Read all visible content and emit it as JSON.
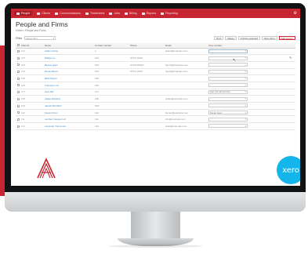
{
  "nav": {
    "items": [
      {
        "label": "People",
        "icon": "people-icon",
        "active": true
      },
      {
        "label": "Clients",
        "icon": "clients-icon"
      },
      {
        "label": "Communications",
        "icon": "communications-icon"
      },
      {
        "label": "Timesheets",
        "icon": "timesheets-icon"
      },
      {
        "label": "Jobs",
        "icon": "jobs-icon"
      },
      {
        "label": "Billing",
        "icon": "billing-icon"
      },
      {
        "label": "Reports",
        "icon": "reports-icon"
      },
      {
        "label": "Reporting",
        "icon": "reporting-icon"
      }
    ],
    "settings_icon": "gear-icon"
  },
  "page": {
    "title": "People and Firms",
    "breadcrumb": "Home / People and Firms"
  },
  "filters": {
    "label": "Filter",
    "select_value": "Select filter",
    "actions": [
      "Print",
      "Merge",
      "Archive selected",
      "New client",
      "Add person"
    ]
  },
  "table": {
    "headers": [
      "Client #",
      "Name",
      "Contact number",
      "Phone",
      "Email",
      "Xero contact"
    ],
    "rows": [
      {
        "id": "101",
        "name": "Adam Young",
        "contact": "1",
        "phone": "",
        "email": "adam@example.com",
        "xero": "",
        "focused": true
      },
      {
        "id": "102",
        "name": "Bridge Inc",
        "contact": "102",
        "phone": "07711 0129",
        "email": "",
        "xero": ""
      },
      {
        "id": "103",
        "name": "Becca Lloyd",
        "contact": "103",
        "phone": "01763 81921",
        "email": "becca@example.com",
        "xero": ""
      },
      {
        "id": "104",
        "name": "Derek Moore",
        "contact": "104",
        "phone": "07711 0129",
        "email": "derek@example.com",
        "xero": ""
      },
      {
        "id": "105",
        "name": "Eliza Reyes",
        "contact": "105",
        "phone": "",
        "email": "",
        "xero": ""
      },
      {
        "id": "106",
        "name": "Frampton Ltd",
        "contact": "106",
        "phone": "",
        "email": "",
        "xero": ""
      },
      {
        "id": "107",
        "name": "Hari Jain",
        "contact": "107",
        "phone": "",
        "email": "",
        "xero": "Hari Jain Enterprises"
      },
      {
        "id": "108",
        "name": "Isabel Hawkins",
        "contact": "108",
        "phone": "",
        "email": "isabel@example.com",
        "xero": ""
      },
      {
        "id": "109",
        "name": "Jacobs Brothers",
        "contact": "109",
        "phone": "",
        "email": "",
        "xero": ""
      },
      {
        "id": "110",
        "name": "Kieran Dunn",
        "contact": "110",
        "phone": "",
        "email": "kieran@example.com",
        "xero": "Kieran Dunn"
      },
      {
        "id": "111",
        "name": "Lambert Games Ltd",
        "contact": "111",
        "phone": "",
        "email": "info@example.com",
        "xero": ""
      },
      {
        "id": "112",
        "name": "Lavender Tree Fund",
        "contact": "112",
        "phone": "",
        "email": "hello@example.com",
        "xero": ""
      }
    ]
  },
  "branding": {
    "left_logo": "accountancy-manager-logo",
    "xero_logo_text": "xero",
    "colors": {
      "brand_red": "#c62531",
      "xero_blue": "#13b5ea"
    }
  }
}
